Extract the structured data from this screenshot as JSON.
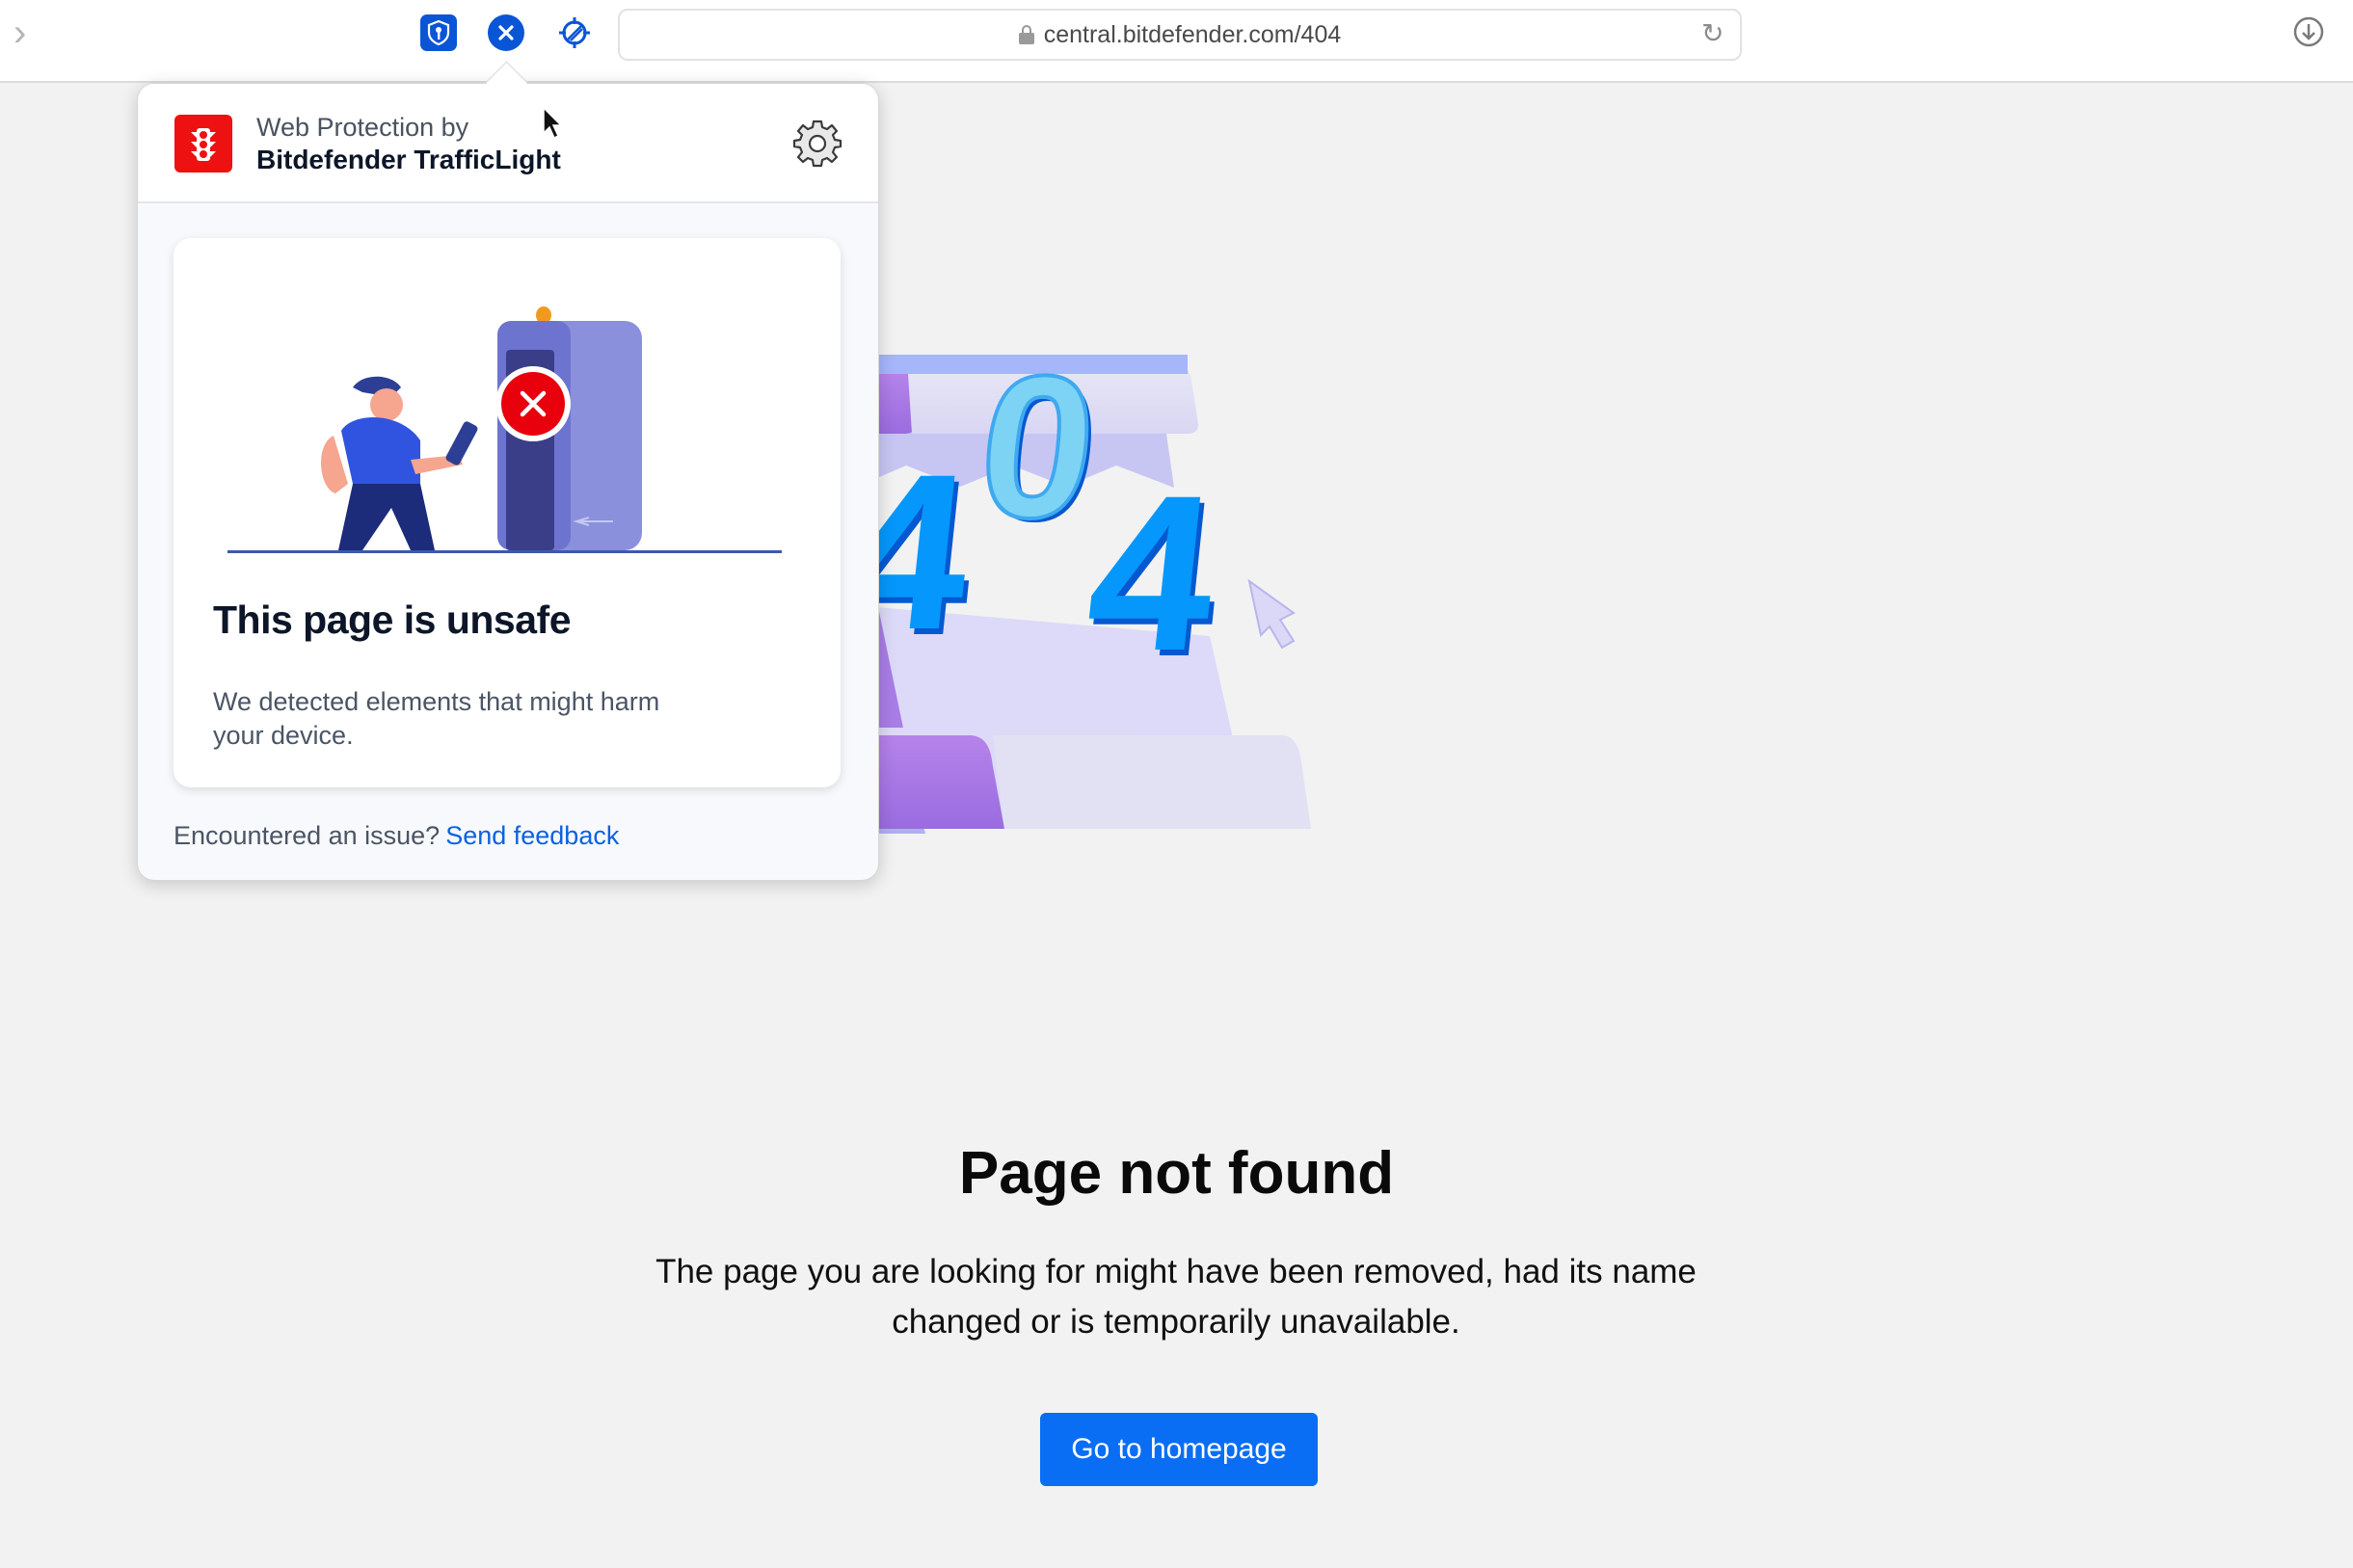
{
  "browser": {
    "url": "central.bitdefender.com/404",
    "extensions": [
      {
        "name": "password-manager-extension"
      },
      {
        "name": "trafficlight-extension"
      },
      {
        "name": "anti-tracker-extension"
      }
    ]
  },
  "popup": {
    "header_line1": "Web Protection by",
    "header_line2": "Bitdefender TrafficLight",
    "card": {
      "title": "This page is unsafe",
      "description": "We detected elements that might harm your device."
    },
    "footer_text": "Encountered an issue?",
    "feedback_link": "Send feedback",
    "colors": {
      "brand_red": "#ee1111",
      "link_blue": "#0a62e0"
    }
  },
  "page": {
    "hero_text": "404",
    "title": "Page not found",
    "description": "The page you are looking for might have been removed, had its name changed or is temporarily unavailable.",
    "button_label": "Go to homepage",
    "colors": {
      "button": "#0a6ef5",
      "background": "#f2f2f2"
    }
  }
}
